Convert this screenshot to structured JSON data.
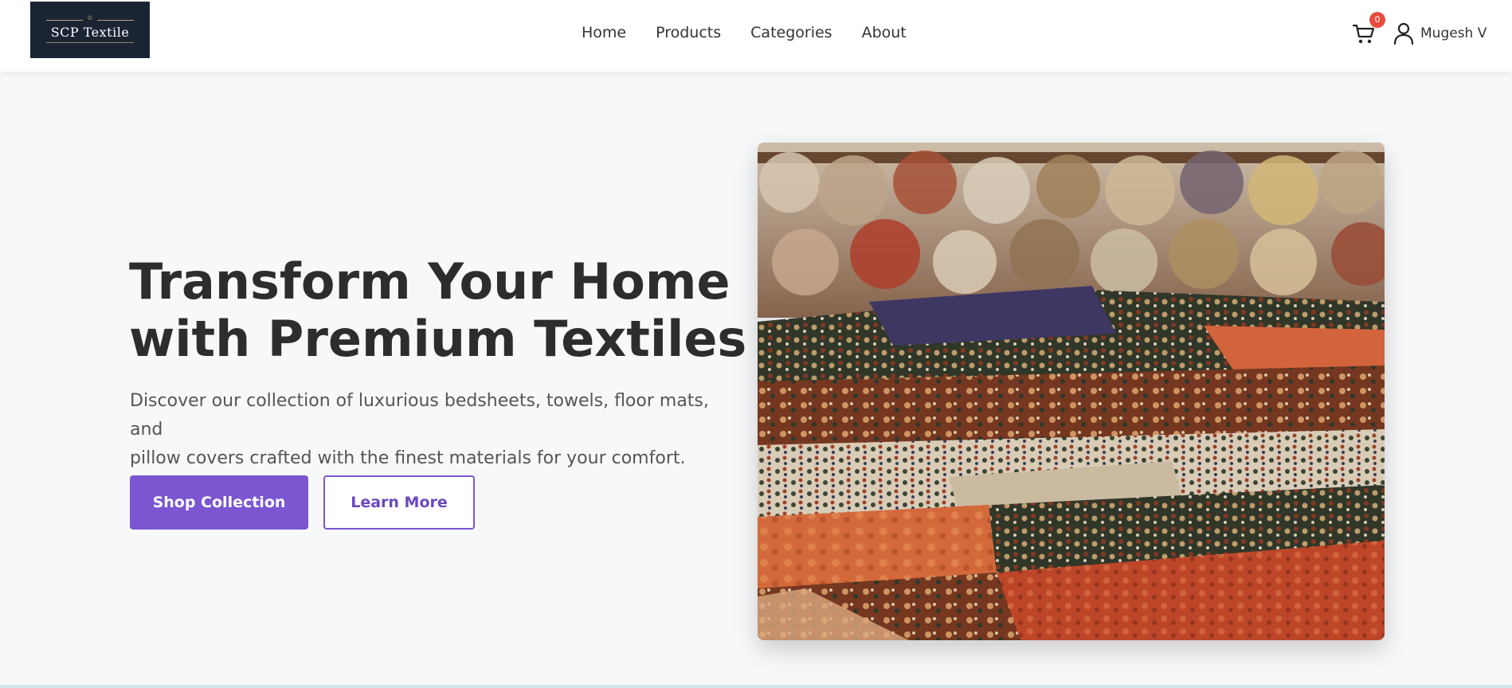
{
  "brand": {
    "logo_text": "SCP Textile",
    "colors": {
      "logo_bg": "#1b2433",
      "accent": "#7b56d0",
      "badge": "#e84b3c"
    }
  },
  "nav": {
    "items": [
      {
        "label": "Home"
      },
      {
        "label": "Products"
      },
      {
        "label": "Categories"
      },
      {
        "label": "About"
      }
    ]
  },
  "cart": {
    "icon": "cart-icon",
    "count": "0"
  },
  "user": {
    "icon": "user-icon",
    "name": "Mugesh V"
  },
  "hero": {
    "title_line1": "Transform Your Home",
    "title_line2": "with Premium Textiles",
    "subtitle_line1": "Discover our collection of luxurious bedsheets, towels, floor mats, and",
    "subtitle_line2": "pillow covers crafted with the finest materials for your comfort.",
    "primary_button": "Shop Collection",
    "secondary_button": "Learn More"
  }
}
